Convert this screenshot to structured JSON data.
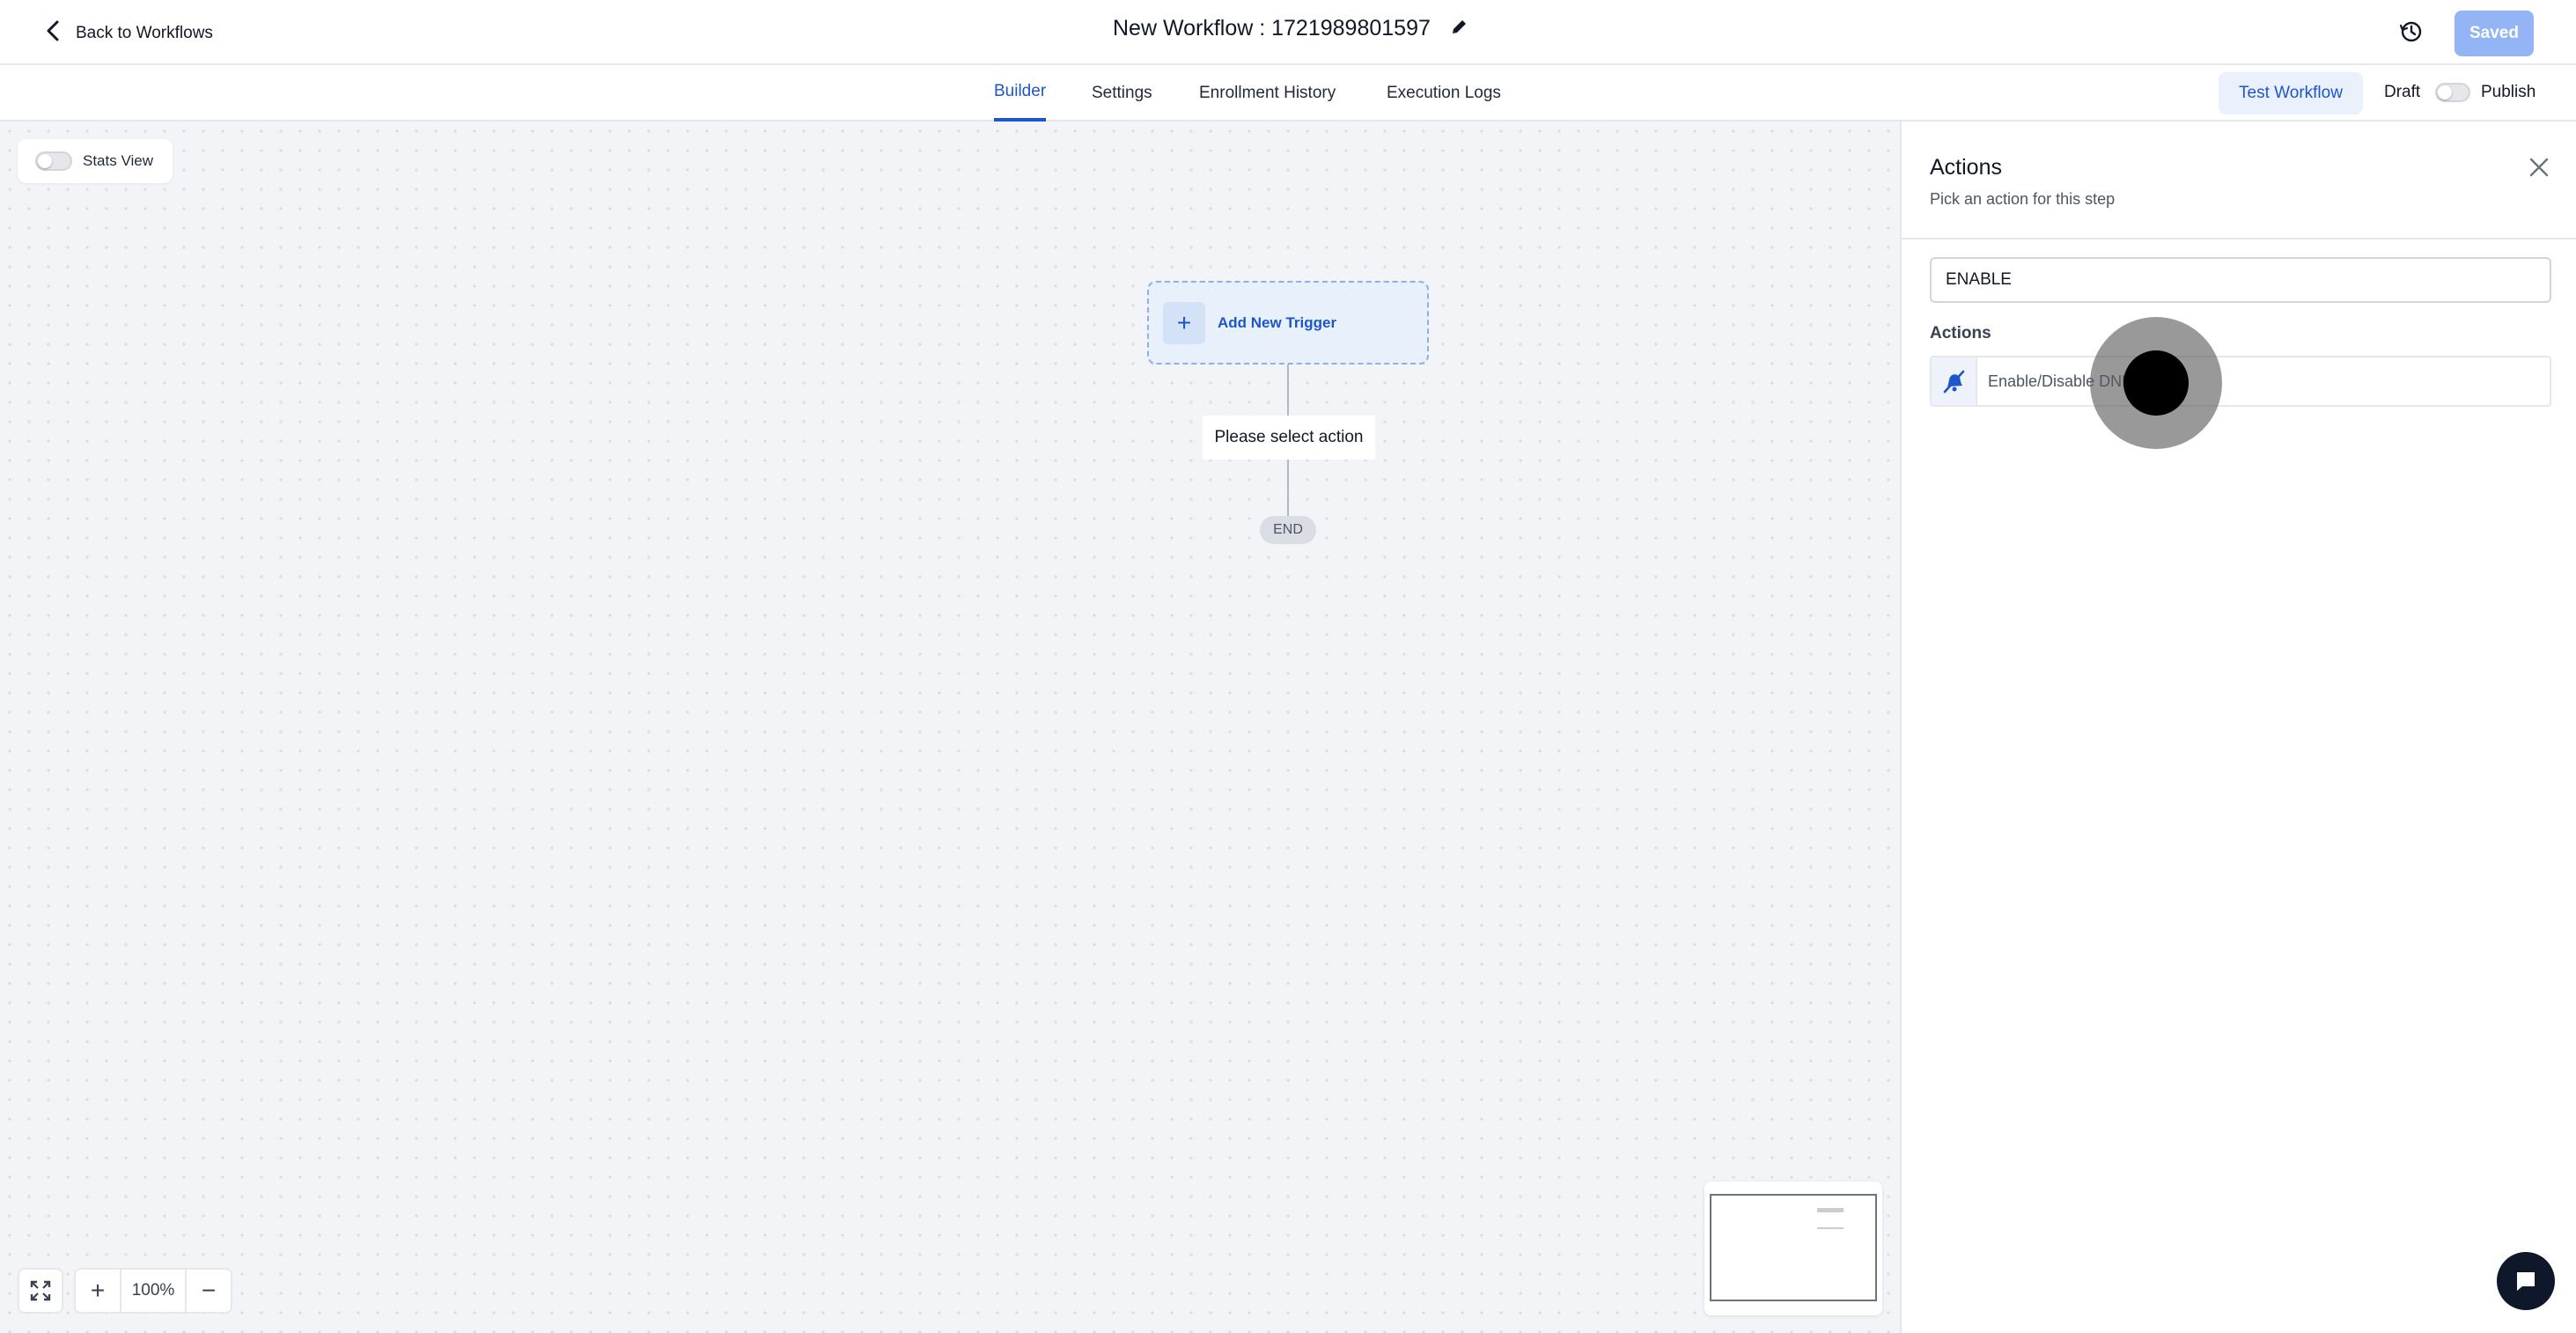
{
  "header": {
    "back_label": "Back to Workflows",
    "title": "New Workflow : 1721989801597",
    "saved_label": "Saved"
  },
  "tabs": [
    {
      "label": "Builder",
      "active": true
    },
    {
      "label": "Settings",
      "active": false
    },
    {
      "label": "Enrollment History",
      "active": false
    },
    {
      "label": "Execution Logs",
      "active": false
    }
  ],
  "toolbar": {
    "test_label": "Test Workflow",
    "draft_label": "Draft",
    "publish_label": "Publish",
    "published": false
  },
  "canvas": {
    "stats_label": "Stats View",
    "stats_enabled": false,
    "trigger_label": "Add New Trigger",
    "trigger_icon": "plus-icon",
    "action_placeholder": "Please select action",
    "end_label": "END",
    "zoom_label": "100%"
  },
  "panel": {
    "title": "Actions",
    "subtitle": "Pick an action for this step",
    "search_value": "ENABLE",
    "section_label": "Actions",
    "items": [
      {
        "label": "Enable/Disable DND",
        "icon": "bell-off-icon"
      }
    ]
  },
  "colors": {
    "accent": "#1d56c9",
    "saved_button": "#93b4f5",
    "canvas_bg": "#f3f4f7"
  }
}
